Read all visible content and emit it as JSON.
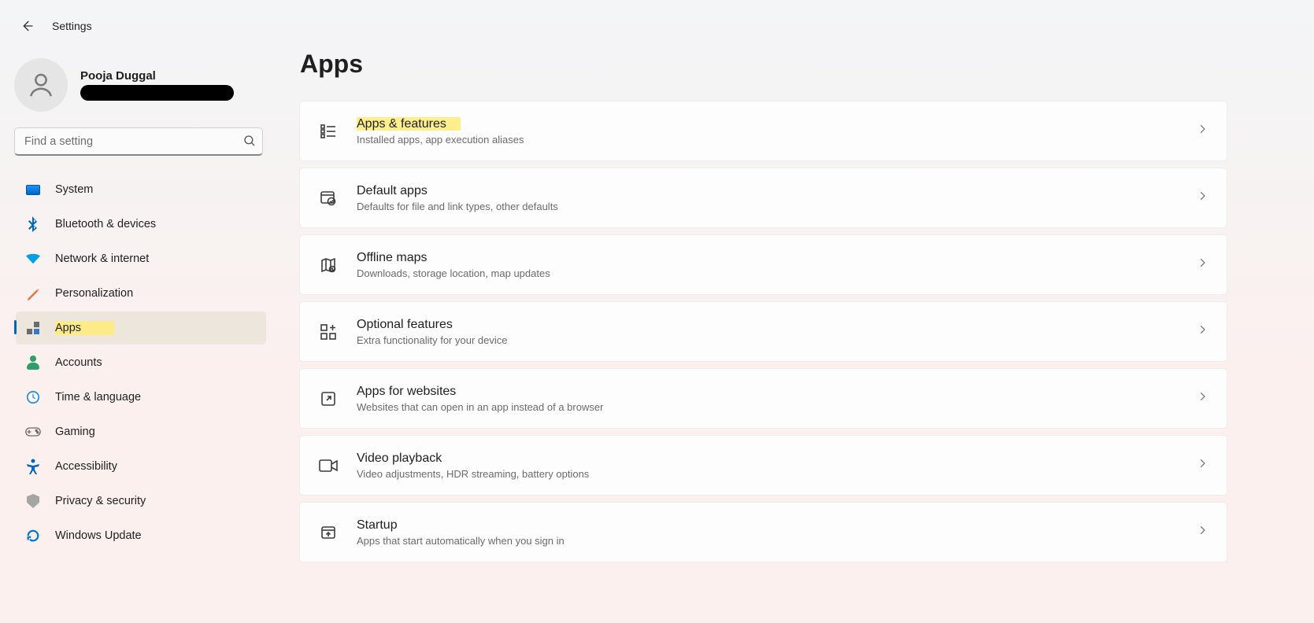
{
  "header": {
    "title": "Settings"
  },
  "profile": {
    "name": "Pooja Duggal"
  },
  "search": {
    "placeholder": "Find a setting"
  },
  "nav": [
    {
      "key": "system",
      "label": "System",
      "icon": "system"
    },
    {
      "key": "bluetooth",
      "label": "Bluetooth & devices",
      "icon": "bt"
    },
    {
      "key": "network",
      "label": "Network & internet",
      "icon": "net"
    },
    {
      "key": "personalization",
      "label": "Personalization",
      "icon": "pers"
    },
    {
      "key": "apps",
      "label": "Apps",
      "icon": "apps",
      "active": true,
      "highlight": true
    },
    {
      "key": "accounts",
      "label": "Accounts",
      "icon": "acct"
    },
    {
      "key": "time",
      "label": "Time & language",
      "icon": "time"
    },
    {
      "key": "gaming",
      "label": "Gaming",
      "icon": "game"
    },
    {
      "key": "accessibility",
      "label": "Accessibility",
      "icon": "access"
    },
    {
      "key": "privacy",
      "label": "Privacy & security",
      "icon": "shield"
    },
    {
      "key": "update",
      "label": "Windows Update",
      "icon": "update"
    }
  ],
  "page": {
    "title": "Apps"
  },
  "cards": [
    {
      "key": "apps-features",
      "title": "Apps & features",
      "sub": "Installed apps, app execution aliases",
      "icon": "list",
      "highlight": true
    },
    {
      "key": "default-apps",
      "title": "Default apps",
      "sub": "Defaults for file and link types, other defaults",
      "icon": "defapp"
    },
    {
      "key": "offline-maps",
      "title": "Offline maps",
      "sub": "Downloads, storage location, map updates",
      "icon": "map"
    },
    {
      "key": "optional-features",
      "title": "Optional features",
      "sub": "Extra functionality for your device",
      "icon": "addsq"
    },
    {
      "key": "apps-websites",
      "title": "Apps for websites",
      "sub": "Websites that can open in an app instead of a browser",
      "icon": "openext"
    },
    {
      "key": "video-playback",
      "title": "Video playback",
      "sub": "Video adjustments, HDR streaming, battery options",
      "icon": "video"
    },
    {
      "key": "startup",
      "title": "Startup",
      "sub": "Apps that start automatically when you sign in",
      "icon": "startup"
    }
  ]
}
